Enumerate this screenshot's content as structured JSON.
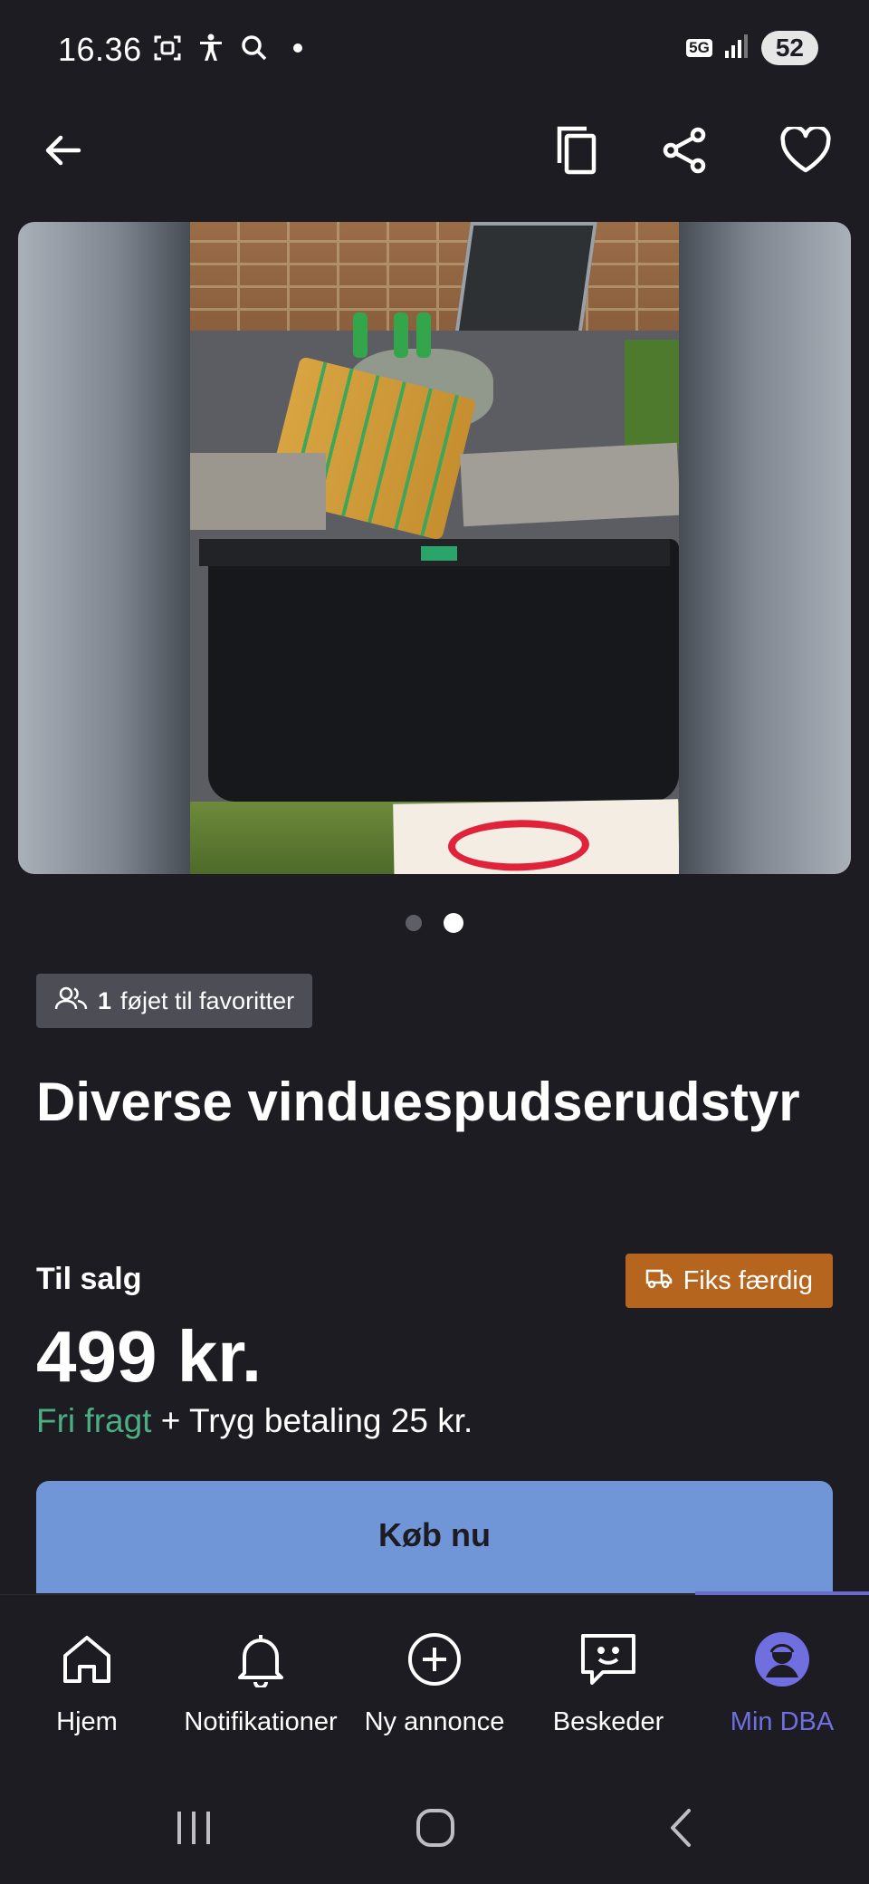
{
  "status_bar": {
    "time": "16.36",
    "network": "5G",
    "battery": "52"
  },
  "header": {
    "back_icon": "arrow-left-icon",
    "copy_icon": "copy-icon",
    "share_icon": "share-icon",
    "favorite_icon": "heart-icon"
  },
  "gallery": {
    "image_count": 2,
    "active_index": 1
  },
  "favorites": {
    "count": "1",
    "text": "føjet til favoritter"
  },
  "listing": {
    "title": "Diverse vinduespudserudstyr",
    "sale_label": "Til salg",
    "badge": "Fiks færdig",
    "price": "499 kr.",
    "free_shipping": "Fri fragt",
    "payment_note": "+ Tryg betaling 25 kr."
  },
  "buy_button": {
    "label": "Køb nu"
  },
  "bottom_nav": {
    "items": [
      {
        "label": "Hjem",
        "icon": "home-icon"
      },
      {
        "label": "Notifikationer",
        "icon": "bell-icon"
      },
      {
        "label": "Ny annonce",
        "icon": "plus-circle-icon"
      },
      {
        "label": "Beskeder",
        "icon": "message-icon"
      },
      {
        "label": "Min DBA",
        "icon": "profile-icon"
      }
    ],
    "active_index": 4
  },
  "colors": {
    "background": "#1c1c22",
    "accent": "#6f6fe0",
    "buy_button": "#7096d8",
    "badge": "#b5651d",
    "free_shipping": "#4caf81"
  }
}
